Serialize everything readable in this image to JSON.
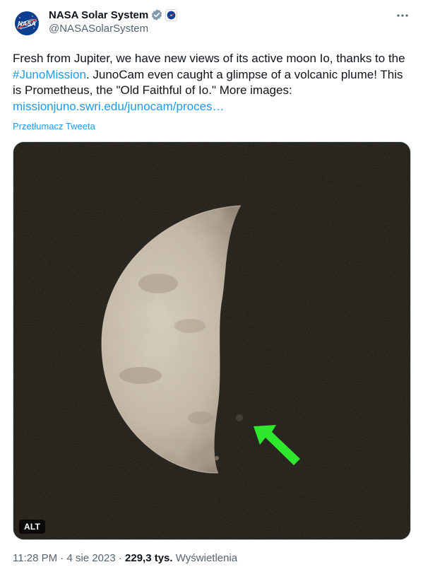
{
  "author": {
    "display_name": "NASA Solar System",
    "handle": "@NASASolarSystem",
    "avatar_icon": "nasa-meatball-logo",
    "verified_icon": "gray-verified-badge",
    "affiliation_icon": "nasa-affiliation-badge"
  },
  "more_icon": "more-options-icon",
  "tweet": {
    "text_part1": "Fresh from Jupiter, we have new views of its active moon Io, thanks to the ",
    "hashtag": "#JunoMission",
    "text_part2": ". JunoCam even caught a glimpse of a volcanic plume! This is Prometheus, the \"Old Faithful of Io.\" More images: ",
    "link": "missionjuno.swri.edu/junocam/proces…",
    "translate_label": "Przetłumacz Tweeta"
  },
  "media": {
    "alt_label": "ALT",
    "arrow_color": "#2ee82e"
  },
  "meta": {
    "time": "11:28 PM",
    "separator": " · ",
    "date": "4 sie 2023",
    "views_count": "229,3 tys.",
    "views_label": "Wyświetlenia"
  },
  "colors": {
    "link": "#1d9bf0",
    "text": "#0f1419",
    "secondary": "#536471"
  }
}
